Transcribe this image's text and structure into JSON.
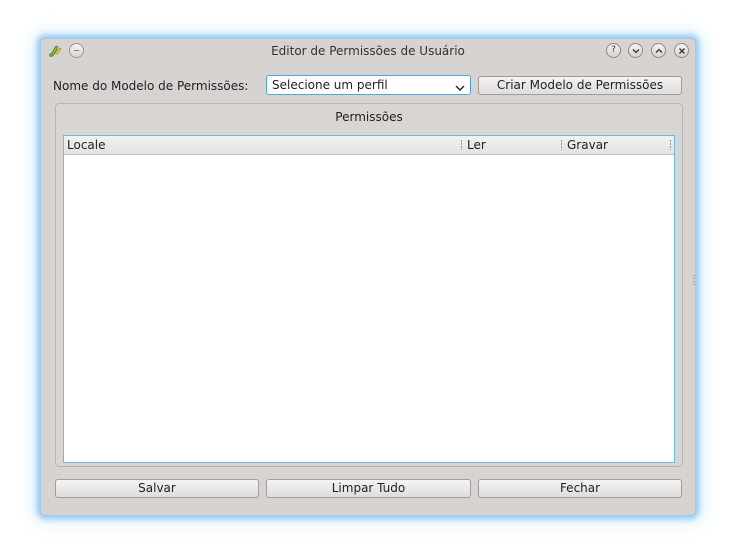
{
  "window": {
    "title": "Editor de Permissões de Usuário",
    "controls": [
      "help-icon",
      "minimize-icon",
      "maximize-icon",
      "close-icon"
    ]
  },
  "form": {
    "template_label": "Nome do Modelo de Permissões:",
    "profile_select": {
      "selected": "Selecione um perfil"
    },
    "create_template_button": "Criar Modelo de Permissões"
  },
  "permissions": {
    "group_title": "Permissões",
    "columns": [
      "Locale",
      "Ler",
      "Gravar"
    ],
    "rows": []
  },
  "footer": {
    "save_button": "Salvar",
    "clear_all_button": "Limpar Tudo",
    "close_button": "Fechar"
  },
  "colors": {
    "window_background": "#d6d3d0",
    "focus_accent": "#4ea7dd",
    "window_glow": "#50aaeb"
  }
}
